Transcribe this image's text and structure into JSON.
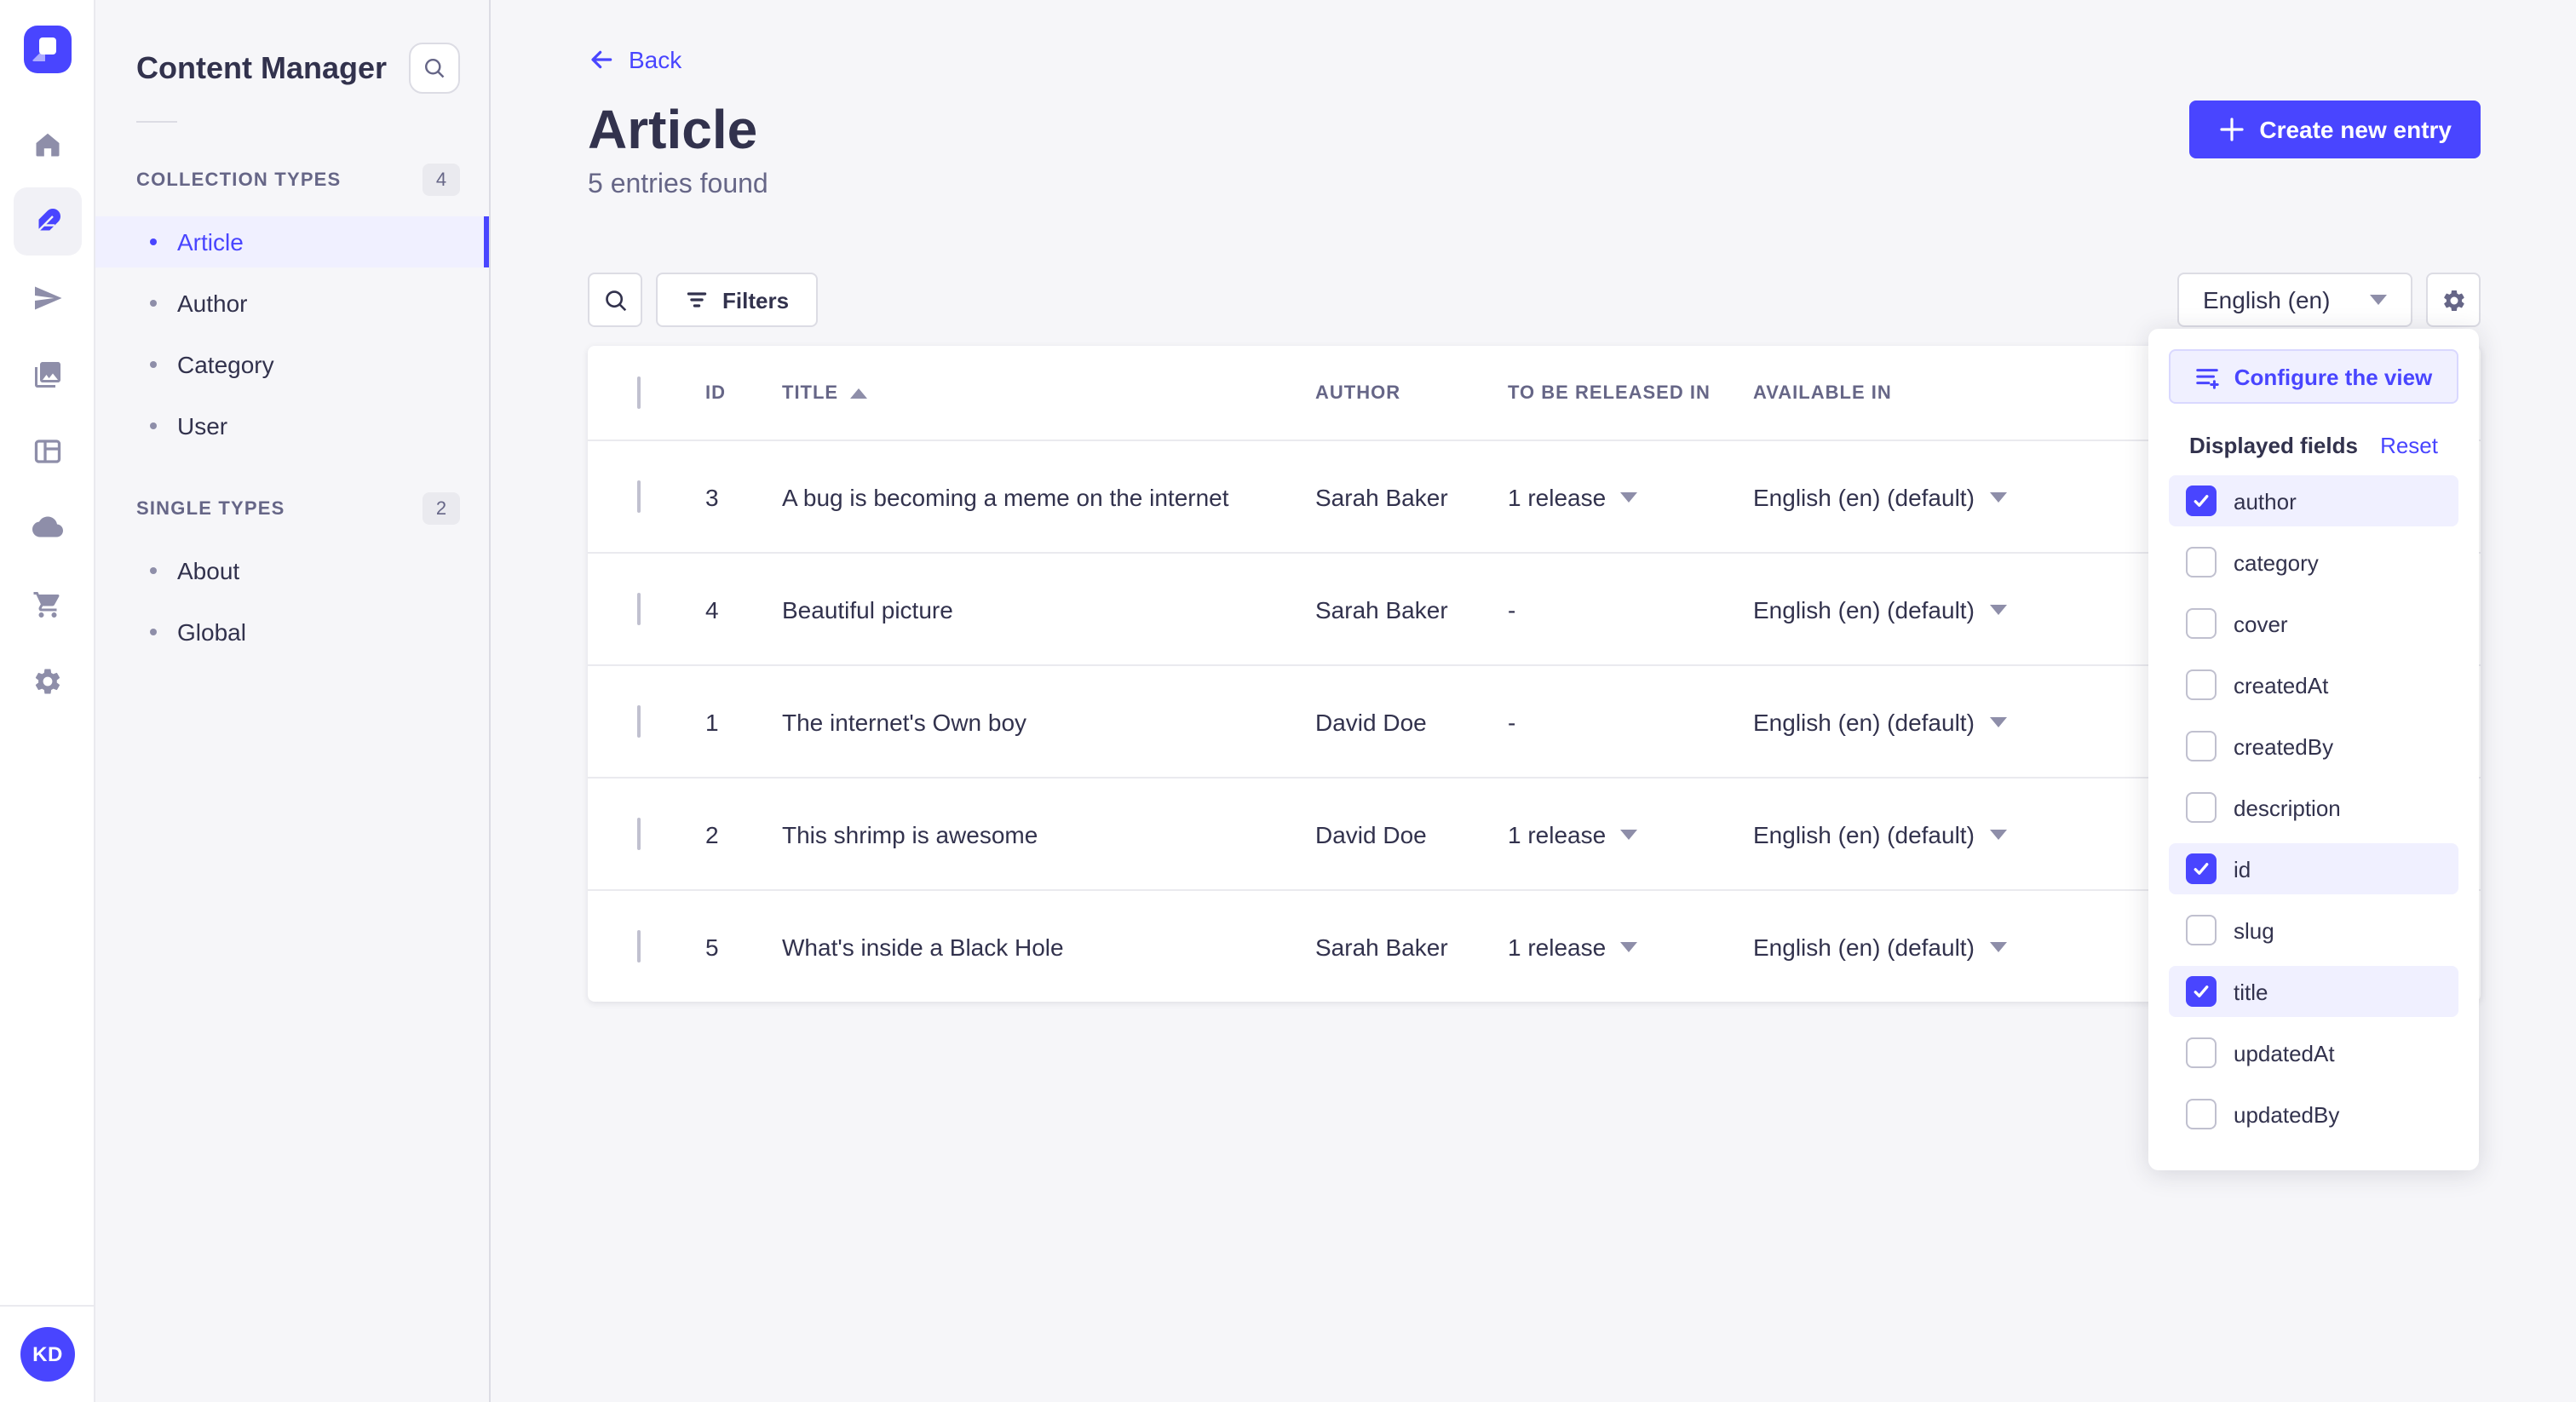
{
  "colors": {
    "primary": "#4945ff",
    "primary_light_bg": "#f0f0ff",
    "primary_border": "#d9d8ff",
    "text": "#32324d",
    "text_secondary": "#666687",
    "text_muted": "#8e8ea9",
    "border": "#dcdce4",
    "divider": "#eaeaef",
    "background": "#f6f6f9"
  },
  "nav": {
    "logo": "strapi-logo",
    "items": [
      {
        "icon": "home-icon",
        "active": false
      },
      {
        "icon": "content-manager-icon",
        "active": true
      },
      {
        "icon": "releases-icon",
        "active": false
      },
      {
        "icon": "media-library-icon",
        "active": false
      },
      {
        "icon": "content-type-builder-icon",
        "active": false
      },
      {
        "icon": "deploy-icon",
        "active": false
      },
      {
        "icon": "marketplace-icon",
        "active": false
      },
      {
        "icon": "settings-icon",
        "active": false
      }
    ],
    "avatar_initials": "KD"
  },
  "sidebar": {
    "title": "Content Manager",
    "collection_types": {
      "label": "COLLECTION TYPES",
      "count": "4",
      "items": [
        {
          "label": "Article",
          "active": true
        },
        {
          "label": "Author",
          "active": false
        },
        {
          "label": "Category",
          "active": false
        },
        {
          "label": "User",
          "active": false
        }
      ]
    },
    "single_types": {
      "label": "SINGLE TYPES",
      "count": "2",
      "items": [
        {
          "label": "About",
          "active": false
        },
        {
          "label": "Global",
          "active": false
        }
      ]
    }
  },
  "header": {
    "back_label": "Back",
    "title": "Article",
    "subtitle": "5 entries found",
    "create_label": "Create new entry"
  },
  "toolbar": {
    "filters_label": "Filters",
    "locale_value": "English (en)"
  },
  "table": {
    "columns": {
      "id": "ID",
      "title": "TITLE",
      "author": "AUTHOR",
      "release": "TO BE RELEASED IN",
      "available": "AVAILABLE IN"
    },
    "sort": {
      "column": "TITLE",
      "direction": "asc"
    },
    "rows": [
      {
        "id": "3",
        "title": "A bug is becoming a meme on the internet",
        "author": "Sarah Baker",
        "release": "1 release",
        "has_release_menu": true,
        "available": "English (en) (default)"
      },
      {
        "id": "4",
        "title": "Beautiful picture",
        "author": "Sarah Baker",
        "release": "-",
        "has_release_menu": false,
        "available": "English (en) (default)"
      },
      {
        "id": "1",
        "title": "The internet's Own boy",
        "author": "David Doe",
        "release": "-",
        "has_release_menu": false,
        "available": "English (en) (default)"
      },
      {
        "id": "2",
        "title": "This shrimp is awesome",
        "author": "David Doe",
        "release": "1 release",
        "has_release_menu": true,
        "available": "English (en) (default)"
      },
      {
        "id": "5",
        "title": "What's inside a Black Hole",
        "author": "Sarah Baker",
        "release": "1 release",
        "has_release_menu": true,
        "available": "English (en) (default)"
      }
    ]
  },
  "popover": {
    "configure_label": "Configure the view",
    "fields_title": "Displayed fields",
    "reset_label": "Reset",
    "fields": [
      {
        "label": "author",
        "checked": true
      },
      {
        "label": "category",
        "checked": false
      },
      {
        "label": "cover",
        "checked": false
      },
      {
        "label": "createdAt",
        "checked": false
      },
      {
        "label": "createdBy",
        "checked": false
      },
      {
        "label": "description",
        "checked": false
      },
      {
        "label": "id",
        "checked": true
      },
      {
        "label": "slug",
        "checked": false
      },
      {
        "label": "title",
        "checked": true
      },
      {
        "label": "updatedAt",
        "checked": false
      },
      {
        "label": "updatedBy",
        "checked": false
      }
    ]
  }
}
